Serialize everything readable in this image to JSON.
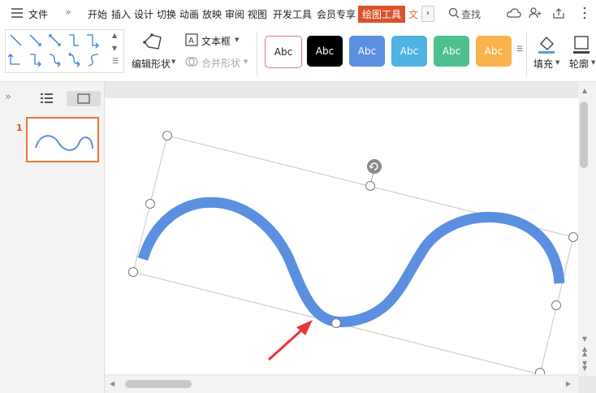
{
  "menubar": {
    "file_label": "文件",
    "tabs": [
      "开始",
      "插入",
      "设计",
      "切换",
      "动画",
      "放映",
      "审阅",
      "视图",
      "开发工具",
      "会员专享",
      "绘图工具",
      "文"
    ],
    "active_tab": "绘图工具",
    "search_label": "查找"
  },
  "ribbon": {
    "edit_shape_label": "编辑形状",
    "text_box_label": "文本框",
    "merge_shape_label": "合并形状",
    "style_labels": [
      "Abc",
      "Abc",
      "Abc",
      "Abc",
      "Abc",
      "Abc"
    ],
    "fill_label": "填充",
    "outline_label": "轮廓",
    "colors": {
      "style1_bg": "#ffffff",
      "style1_border": "#e0707a",
      "style2_bg": "#000000",
      "style3_bg": "#5b8fe0",
      "style4_bg": "#4eb3e3",
      "style5_bg": "#4fc08d",
      "style6_bg": "#f8b34c"
    }
  },
  "sidebar": {
    "slide_number": "1"
  },
  "colors": {
    "curve": "#5b8fe0",
    "arrow": "#ee3333",
    "active_tab_bg": "#d9542b",
    "thumb_border": "#e07a3a"
  }
}
